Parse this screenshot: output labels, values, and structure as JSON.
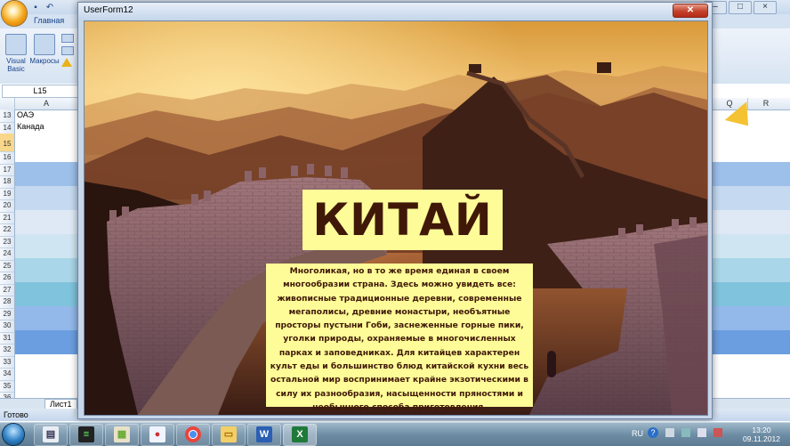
{
  "excel": {
    "ribbon_tabs": [
      "Главная"
    ],
    "ribbon": {
      "visual_basic_label": "Visual Basic",
      "macros_label": "Макросы"
    },
    "name_box": "L15",
    "columns": [
      "A",
      "Q",
      "R"
    ],
    "rows": [
      "13",
      "14",
      "15",
      "16",
      "17",
      "18",
      "19",
      "20",
      "21",
      "22",
      "23",
      "24",
      "25",
      "26",
      "27",
      "28",
      "29",
      "30",
      "31",
      "32",
      "33",
      "34",
      "35",
      "36"
    ],
    "cells": {
      "a13": "ОАЭ",
      "a14": "Канада"
    },
    "sheet_tab": "Лист1",
    "status": "Готово"
  },
  "userform": {
    "title": "UserForm12",
    "heading": "КИТАЙ",
    "description": "Многоликая, но в то же время единая в своем многообразии страна. Здесь можно увидеть все: живописные традиционные деревни, современные мегаполисы, древние монастыри, необъятные просторы пустыни Гоби, заснеженные горные пики, уголки природы, охраняемые в многочисленных парках и заповедниках. Для китайцев характерен культ еды и большинство блюд китайской кухни весь остальной мир воспринимает крайне экзотическими в силу их разнообразия, насыщенности пряностями и необычного способа приготовления.",
    "colors": {
      "panel_bg": "#fdfc98",
      "text": "#401808"
    }
  },
  "taskbar": {
    "language": "RU",
    "time": "13:20",
    "date": "09.11.2012",
    "apps": [
      "explorer-icon",
      "media-player-icon",
      "winrar-icon",
      "paint-icon",
      "chrome-icon",
      "folder-icon",
      "word-icon",
      "excel-icon"
    ]
  }
}
